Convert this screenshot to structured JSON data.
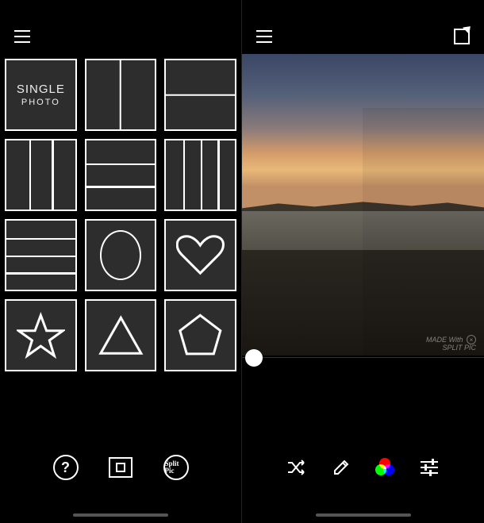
{
  "left": {
    "single_template": {
      "line1": "SINGLE",
      "line2": "PHOTO"
    },
    "templates": [
      "single",
      "vertical-2",
      "horizontal-2",
      "vertical-3",
      "horizontal-3",
      "vertical-4",
      "horizontal-4",
      "circle",
      "heart",
      "star",
      "triangle",
      "pentagon"
    ],
    "toolbar": {
      "help": "?",
      "camera": "camera",
      "badge": "Split Pic"
    }
  },
  "right": {
    "watermark": {
      "line1": "MADE With",
      "line2": "SPLIT PIC",
      "close": "×"
    },
    "slider_value": 0,
    "toolbar": {
      "shuffle": "shuffle",
      "edit": "edit",
      "color": "color",
      "adjust": "adjust"
    }
  }
}
